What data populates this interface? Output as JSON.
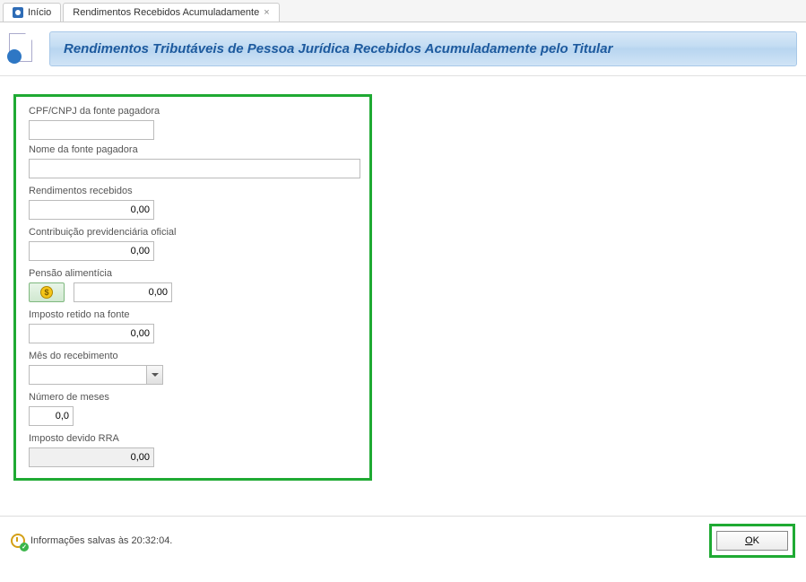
{
  "tabs": {
    "home": "Início",
    "current": "Rendimentos Recebidos Acumuladamente"
  },
  "header": {
    "title": "Rendimentos Tributáveis de Pessoa Jurídica Recebidos Acumuladamente pelo Titular"
  },
  "form": {
    "cpf_label": "CPF/CNPJ da fonte pagadora",
    "cpf_value": "",
    "nome_label": "Nome da fonte pagadora",
    "nome_value": "",
    "rendimentos_label": "Rendimentos recebidos",
    "rendimentos_value": "0,00",
    "contrib_label": "Contribuição previdenciária oficial",
    "contrib_value": "0,00",
    "pensao_label": "Pensão alimentícia",
    "pensao_value": "0,00",
    "imposto_retido_label": "Imposto retido na fonte",
    "imposto_retido_value": "0,00",
    "mes_label": "Mês do recebimento",
    "mes_value": "",
    "meses_label": "Número de meses",
    "meses_value": "0,0",
    "imposto_devido_label": "Imposto devido RRA",
    "imposto_devido_value": "0,00"
  },
  "footer": {
    "status": "Informações salvas às 20:32:04.",
    "ok_label": "OK",
    "ok_key": "O",
    "ok_rest": "K"
  }
}
